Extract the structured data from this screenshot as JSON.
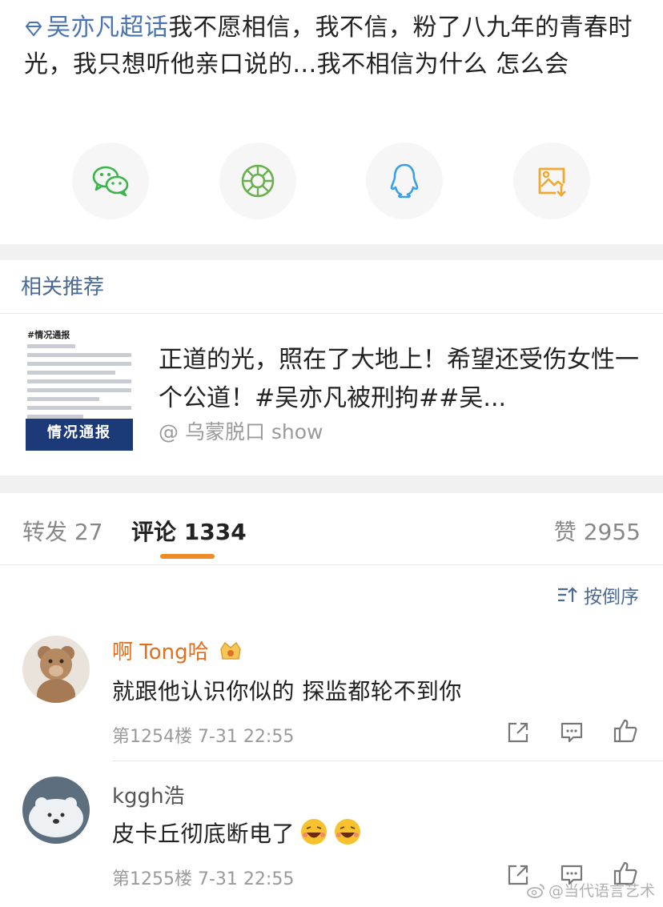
{
  "post": {
    "topic_label": "吴亦凡超话",
    "text": "我不愿相信，我不信，粉了八九年的青春时光，我只想听他亲口说的...我不相信为什么 怎么会"
  },
  "share": {
    "icons": [
      "wechat-icon",
      "moments-icon",
      "qq-icon",
      "save-image-icon"
    ],
    "colors": {
      "wechat": "#39b54a",
      "moments": "#6ab04c",
      "qq": "#3aa0e6",
      "save": "#f0a830"
    }
  },
  "related": {
    "section_title": "相关推荐",
    "thumb_header": "#情况通报",
    "thumb_banner": "情况通报",
    "text": "正道的光，照在了大地上！希望还受伤女性一个公道！#吴亦凡被刑拘##吴...",
    "source": "@ 乌蒙脱口 show"
  },
  "tabs": [
    {
      "label": "转发",
      "count": "27"
    },
    {
      "label": "评论",
      "count": "1334"
    },
    {
      "label": "赞",
      "count": "2955"
    }
  ],
  "sort_label": "按倒序",
  "comments": [
    {
      "name": "啊 Tong哈",
      "text": "就跟他认识你似的 探监都轮不到你",
      "floor": "第1254楼",
      "time": "7-31 22:55",
      "name_color": "#e0701f"
    },
    {
      "name": "kggh浩",
      "text": "皮卡丘彻底断电了",
      "floor": "第1255楼",
      "time": "7-31 22:55",
      "name_color": "#555555"
    }
  ],
  "watermark": "@当代语言艺术",
  "colors": {
    "accent_orange": "#f08a24",
    "link_blue": "#4a73b0"
  }
}
